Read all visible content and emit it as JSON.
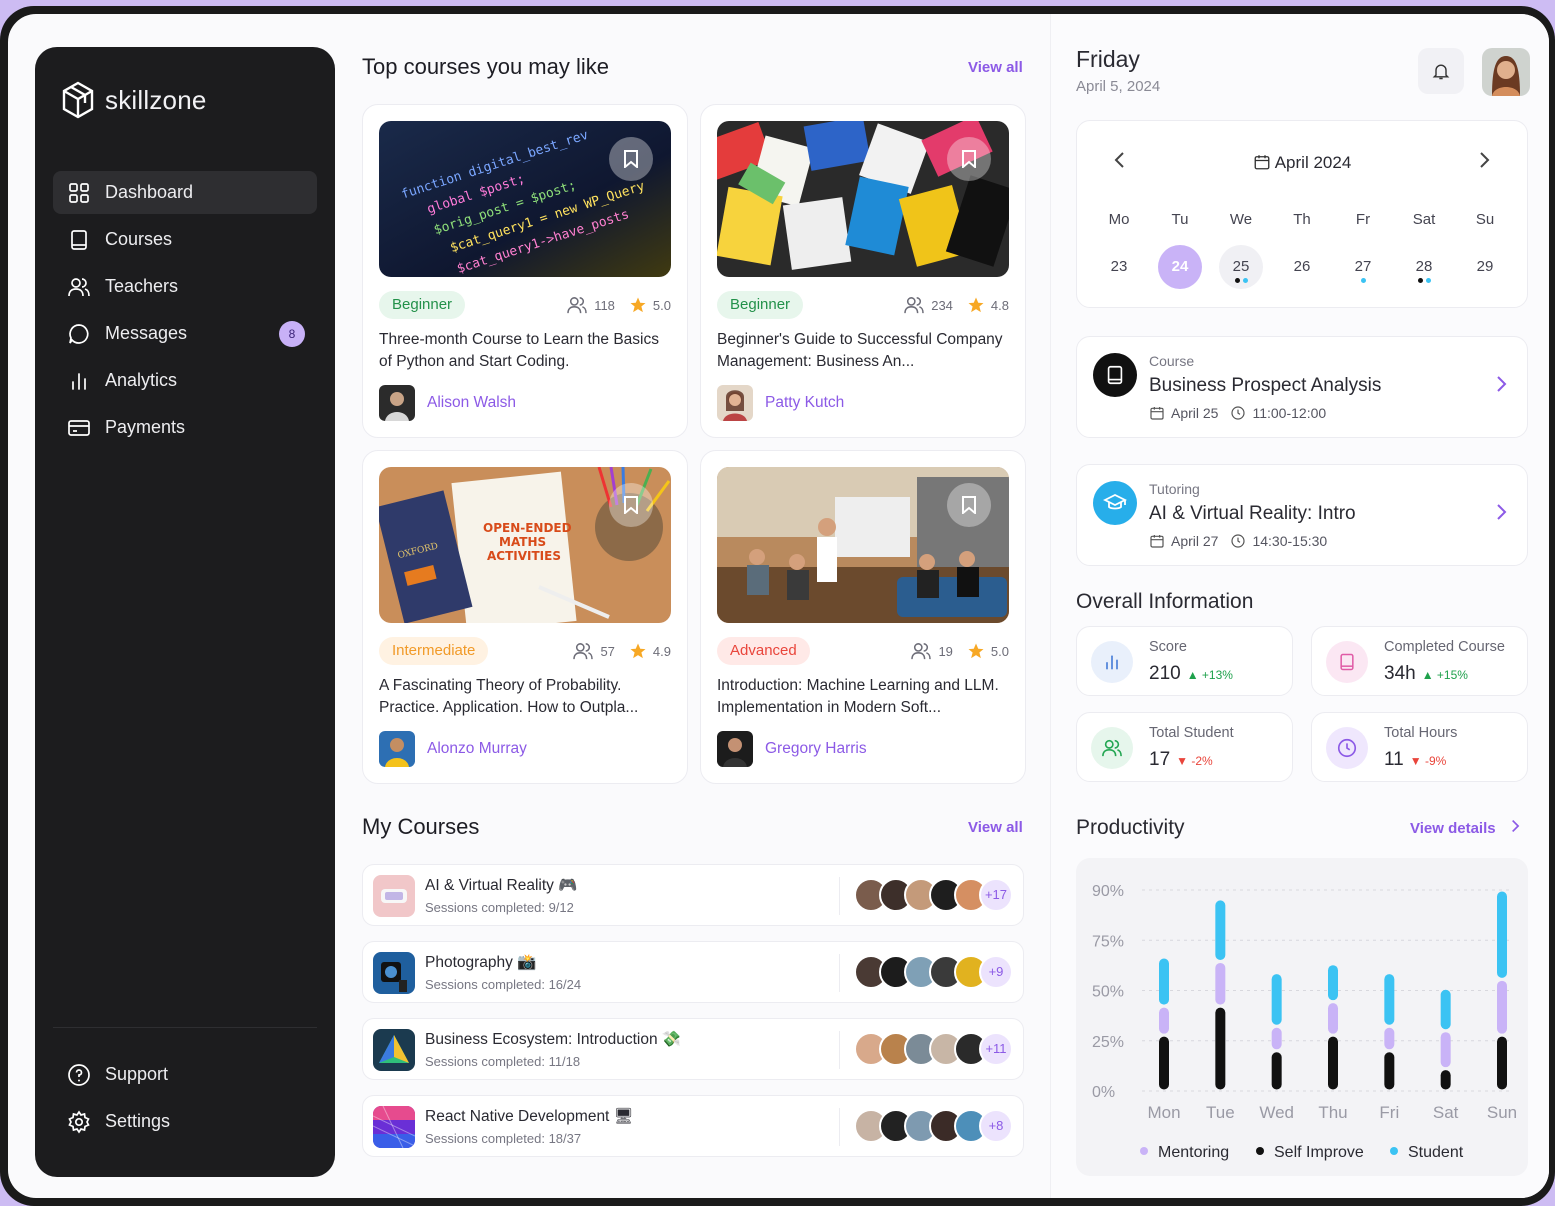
{
  "app": {
    "brand": "skillzone"
  },
  "sidebar": {
    "items": [
      {
        "label": "Dashboard",
        "icon": "grid-icon"
      },
      {
        "label": "Courses",
        "icon": "book-icon"
      },
      {
        "label": "Teachers",
        "icon": "users-icon"
      },
      {
        "label": "Messages",
        "icon": "chat-icon",
        "badge": "8"
      },
      {
        "label": "Analytics",
        "icon": "bar-chart-icon"
      },
      {
        "label": "Payments",
        "icon": "card-icon"
      }
    ],
    "bottom": [
      {
        "label": "Support",
        "icon": "help-icon"
      },
      {
        "label": "Settings",
        "icon": "gear-icon"
      }
    ]
  },
  "top_courses": {
    "title": "Top courses you may like",
    "view_all": "View all",
    "cards": [
      {
        "level": "Beginner",
        "students": "118",
        "rating": "5.0",
        "title": "Three-month Course to Learn the Basics of Python and Start Coding.",
        "author": "Alison Walsh"
      },
      {
        "level": "Beginner",
        "students": "234",
        "rating": "4.8",
        "title": "Beginner's Guide to Successful Company Management: Business An...",
        "author": "Patty Kutch"
      },
      {
        "level": "Intermediate",
        "students": "57",
        "rating": "4.9",
        "title": "A Fascinating Theory of Probability. Practice. Application. How to Outpla...",
        "author": "Alonzo Murray"
      },
      {
        "level": "Advanced",
        "students": "19",
        "rating": "5.0",
        "title": "Introduction: Machine Learning and LLM. Implementation in Modern Soft...",
        "author": "Gregory Harris"
      }
    ]
  },
  "my_courses": {
    "title": "My Courses",
    "view_all": "View all",
    "items": [
      {
        "title": "AI & Virtual Reality 🎮",
        "sessions": "Sessions completed: 9/12",
        "more": "+17"
      },
      {
        "title": "Photography 📸",
        "sessions": "Sessions completed: 16/24",
        "more": "+9"
      },
      {
        "title": "Business Ecosystem: Introduction 💸",
        "sessions": "Sessions completed: 11/18",
        "more": "+11"
      },
      {
        "title": "React Native Development 🖥",
        "sessions": "Sessions completed: 18/37",
        "more": "+8"
      }
    ]
  },
  "header": {
    "day": "Friday",
    "date": "April 5, 2024"
  },
  "calendar": {
    "month": "April 2024",
    "weekdays": [
      "Mo",
      "Tu",
      "We",
      "Th",
      "Fr",
      "Sat",
      "Su"
    ],
    "days": [
      "23",
      "24",
      "25",
      "26",
      "27",
      "28",
      "29"
    ]
  },
  "events": [
    {
      "type": "Course",
      "title": "Business Prospect Analysis",
      "date": "April 25",
      "time": "11:00-12:00"
    },
    {
      "type": "Tutoring",
      "title": "AI & Virtual Reality: Intro",
      "date": "April 27",
      "time": "14:30-15:30"
    }
  ],
  "overall": {
    "title": "Overall Information",
    "stats": [
      {
        "label": "Score",
        "value": "210",
        "delta": "+13%",
        "dir": "up"
      },
      {
        "label": "Completed Course",
        "value": "34h",
        "delta": "+15%",
        "dir": "up"
      },
      {
        "label": "Total Student",
        "value": "17",
        "delta": "-2%",
        "dir": "down"
      },
      {
        "label": "Total Hours",
        "value": "11",
        "delta": "-9%",
        "dir": "down"
      }
    ]
  },
  "productivity": {
    "title": "Productivity",
    "link": "View details"
  },
  "colors": {
    "accent": "#8c5ae6",
    "mentoring": "#c9b3f7",
    "self_improve": "#111111",
    "student": "#3bc3f3"
  },
  "chart_data": {
    "type": "bar",
    "stacked": true,
    "categories": [
      "Mon",
      "Tue",
      "Wed",
      "Thu",
      "Fri",
      "Sat",
      "Sun"
    ],
    "y_ticks": [
      "90%",
      "75%",
      "50%",
      "25%",
      "0%"
    ],
    "ylim": [
      0,
      90
    ],
    "series": [
      {
        "name": "Self Improve",
        "values": [
          25,
          38,
          18,
          25,
          18,
          10,
          25
        ]
      },
      {
        "name": "Mentoring",
        "values": [
          13,
          20,
          11,
          15,
          11,
          17,
          25
        ]
      },
      {
        "name": "Student",
        "values": [
          22,
          28,
          24,
          17,
          24,
          19,
          40
        ]
      }
    ],
    "legend": "bottom"
  }
}
